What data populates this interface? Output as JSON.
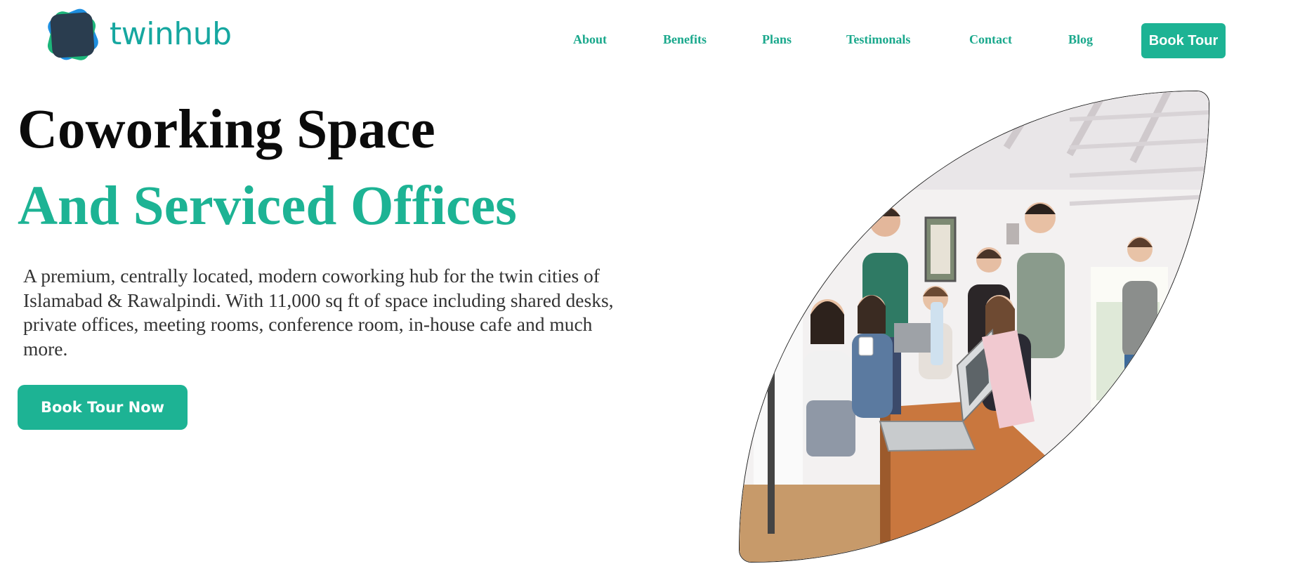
{
  "brand": {
    "name": "twinhub",
    "logo_icon": "twinhub-logo-icon"
  },
  "nav": {
    "links": [
      "About",
      "Benefits",
      "Plans",
      "Testimonals",
      "Contact",
      "Blog"
    ],
    "cta_label": "Book Tour"
  },
  "hero": {
    "title_line1": "Coworking Space",
    "title_line2": "And Serviced Offices",
    "description": "A premium, centrally located, modern coworking hub for the twin cities of Islamabad & Rawalpindi. With 11,000 sq ft of space including shared desks, private offices, meeting rooms, conference room, in-house cafe and much more.",
    "cta_label": "Book Tour Now",
    "image_subject": "coworking-team-photo"
  },
  "colors": {
    "accent": "#1db394",
    "nav_text": "#1aa88c",
    "heading": "#0b0b0b",
    "body_text": "#333333",
    "logo_dark": "#2a3d4f",
    "logo_blue": "#1e8fe0",
    "logo_green": "#1cb67a"
  }
}
